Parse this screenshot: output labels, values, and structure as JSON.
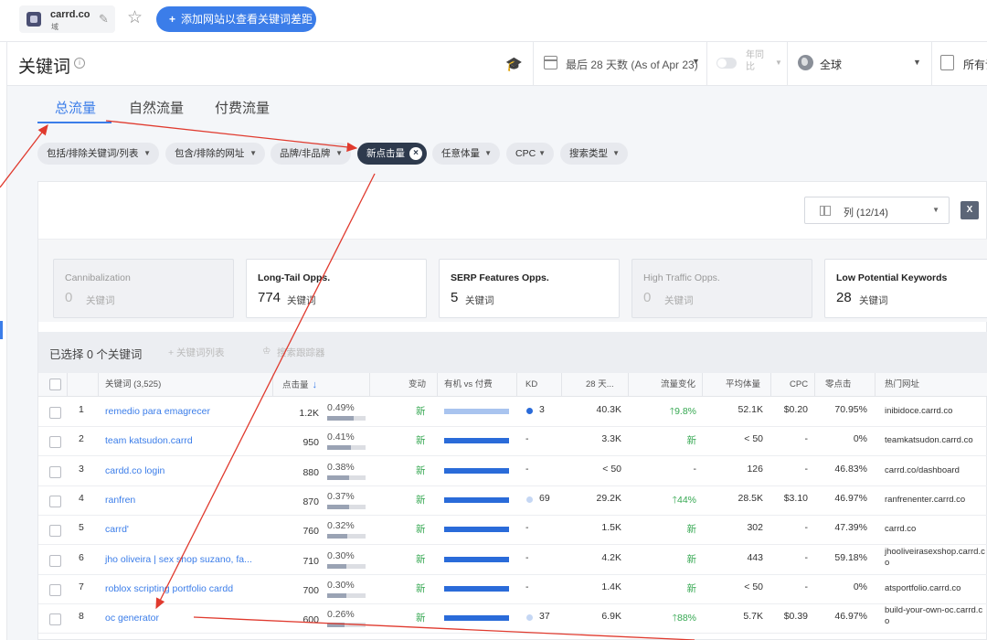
{
  "topbar": {
    "site_name": "carrd.co",
    "site_sub": "域",
    "add_button": "添加网站以查看关键词差距"
  },
  "header": {
    "title": "关键词",
    "date_range": "最后 28 天数 (As of Apr 23)",
    "yoy": "年同比",
    "region": "全球",
    "device": "所有设"
  },
  "tabs": [
    {
      "label": "总流量",
      "active": true
    },
    {
      "label": "自然流量",
      "active": false
    },
    {
      "label": "付费流量",
      "active": false
    }
  ],
  "filters": [
    {
      "label": "包括/排除关键词/列表"
    },
    {
      "label": "包含/排除的网址"
    },
    {
      "label": "品牌/非品牌"
    },
    {
      "label": "新点击量",
      "active": true
    },
    {
      "label": "任意体量"
    },
    {
      "label": "CPC"
    },
    {
      "label": "搜索类型"
    }
  ],
  "columns_button": "列 (12/14)",
  "excel_icon": "X",
  "opportunities": [
    {
      "title": "Cannibalization",
      "count": "0",
      "unit": "关键词",
      "disabled": true
    },
    {
      "title": "Long-Tail Opps.",
      "count": "774",
      "unit": "关键词",
      "disabled": false
    },
    {
      "title": "SERP Features Opps.",
      "count": "5",
      "unit": "关键词",
      "disabled": false
    },
    {
      "title": "High Traffic Opps.",
      "count": "0",
      "unit": "关键词",
      "disabled": true
    },
    {
      "title": "Low Potential Keywords",
      "count": "28",
      "unit": "关键词",
      "disabled": false
    }
  ],
  "selection": {
    "selected_text": "已选择 0 个关键词",
    "list_action": "+ 关键词列表",
    "tracker_action": "搜索跟踪器"
  },
  "table": {
    "headers": {
      "keyword": "关键词 (3,525)",
      "clicks": "点击量",
      "change": "变动",
      "organic_paid": "有机 vs 付费",
      "kd": "KD",
      "days28": "28 天...",
      "traffic_change": "流量变化",
      "avg_volume": "平均体量",
      "cpc": "CPC",
      "zero_click": "零点击",
      "top_url": "热门网址"
    },
    "rows": [
      {
        "n": "1",
        "keyword": "remedio para emagrecer",
        "clicks": "1.2K",
        "pct": "0.49%",
        "pct_val": 0.49,
        "change": "新",
        "organic": 1.0,
        "organic_light": true,
        "kd": "3",
        "kd_dot": "dark",
        "days28": "40.3K",
        "traffic_change": "9.8%",
        "traffic_up": true,
        "avg_volume": "52.1K",
        "cpc": "$0.20",
        "zero_click": "70.95%",
        "url": "inibidoce.carrd.co"
      },
      {
        "n": "2",
        "keyword": "team katsudon.carrd",
        "clicks": "950",
        "pct": "0.41%",
        "pct_val": 0.41,
        "change": "新",
        "organic": 1.0,
        "organic_light": false,
        "kd": "-",
        "kd_dot": "",
        "days28": "3.3K",
        "traffic_change": "新",
        "traffic_up": false,
        "avg_volume": "< 50",
        "cpc": "-",
        "zero_click": "0%",
        "url": "teamkatsudon.carrd.co"
      },
      {
        "n": "3",
        "keyword": "cardd.co login",
        "clicks": "880",
        "pct": "0.38%",
        "pct_val": 0.38,
        "change": "新",
        "organic": 1.0,
        "organic_light": false,
        "kd": "-",
        "kd_dot": "",
        "days28": "< 50",
        "traffic_change": "-",
        "traffic_up": false,
        "avg_volume": "126",
        "cpc": "-",
        "zero_click": "46.83%",
        "url": "carrd.co/dashboard"
      },
      {
        "n": "4",
        "keyword": "ranfren",
        "clicks": "870",
        "pct": "0.37%",
        "pct_val": 0.37,
        "change": "新",
        "organic": 1.0,
        "organic_light": false,
        "kd": "69",
        "kd_dot": "light",
        "days28": "29.2K",
        "traffic_change": "44%",
        "traffic_up": true,
        "avg_volume": "28.5K",
        "cpc": "$3.10",
        "zero_click": "46.97%",
        "url": "ranfrenenter.carrd.co"
      },
      {
        "n": "5",
        "keyword": "carrd'",
        "clicks": "760",
        "pct": "0.32%",
        "pct_val": 0.32,
        "change": "新",
        "organic": 1.0,
        "organic_light": false,
        "kd": "-",
        "kd_dot": "",
        "days28": "1.5K",
        "traffic_change": "新",
        "traffic_up": false,
        "avg_volume": "302",
        "cpc": "-",
        "zero_click": "47.39%",
        "url": "carrd.co"
      },
      {
        "n": "6",
        "keyword": "jho oliveira | sex shop suzano, fa...",
        "clicks": "710",
        "pct": "0.30%",
        "pct_val": 0.3,
        "change": "新",
        "organic": 1.0,
        "organic_light": false,
        "kd": "-",
        "kd_dot": "",
        "days28": "4.2K",
        "traffic_change": "新",
        "traffic_up": false,
        "avg_volume": "443",
        "cpc": "-",
        "zero_click": "59.18%",
        "url": "jhooliveirasexshop.carrd.co"
      },
      {
        "n": "7",
        "keyword": "roblox scripting portfolio cardd",
        "clicks": "700",
        "pct": "0.30%",
        "pct_val": 0.3,
        "change": "新",
        "organic": 1.0,
        "organic_light": false,
        "kd": "-",
        "kd_dot": "",
        "days28": "1.4K",
        "traffic_change": "新",
        "traffic_up": false,
        "avg_volume": "< 50",
        "cpc": "-",
        "zero_click": "0%",
        "url": "atsportfolio.carrd.co"
      },
      {
        "n": "8",
        "keyword": "oc generator",
        "clicks": "600",
        "pct": "0.26%",
        "pct_val": 0.26,
        "change": "新",
        "organic": 1.0,
        "organic_light": false,
        "kd": "37",
        "kd_dot": "light",
        "days28": "6.9K",
        "traffic_change": "88%",
        "traffic_up": true,
        "avg_volume": "5.7K",
        "cpc": "$0.39",
        "zero_click": "46.97%",
        "url": "build-your-own-oc.carrd.co"
      }
    ]
  },
  "colors": {
    "accent": "#3b7de9",
    "green": "#36a852",
    "annotation": "#e03a2e"
  }
}
